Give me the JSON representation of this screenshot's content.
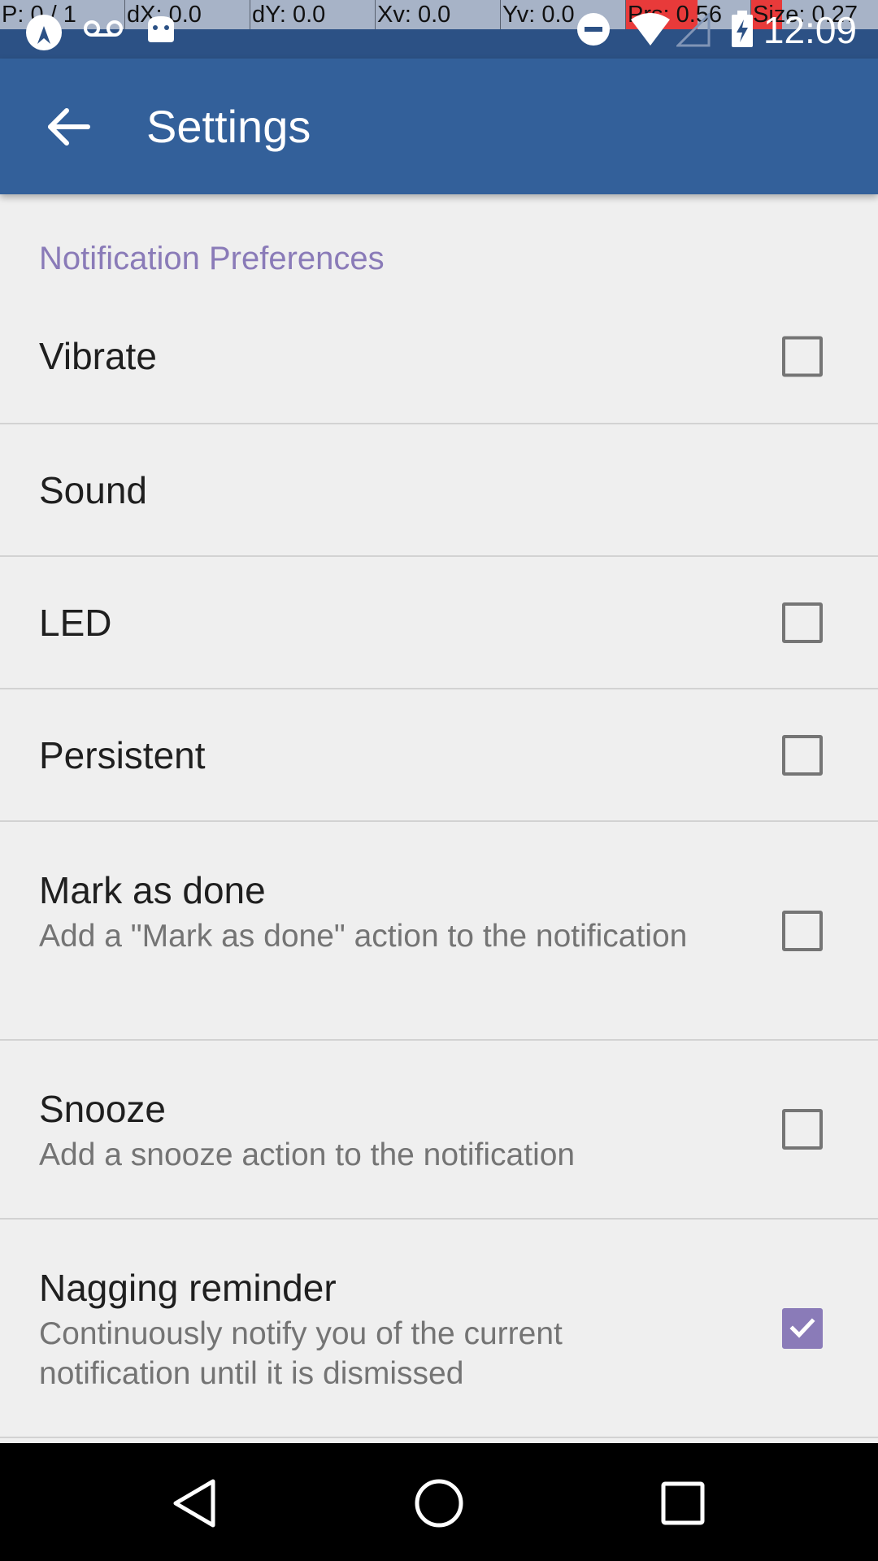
{
  "status_bar": {
    "debug": {
      "pointer": "P: 0 / 1",
      "dx": "dX: 0.0",
      "dy": "dY: 0.0",
      "xv": "Xv: 0.0",
      "yv": "Yv: 0.0",
      "pressure": "Prs: 0.56",
      "size": "Size: 0.27"
    },
    "time": "12:09",
    "icons": [
      "app-notification-icon",
      "voicemail-icon",
      "android-icon",
      "do-not-disturb-icon",
      "wifi-icon",
      "signal-icon",
      "battery-charging-icon"
    ],
    "highlight_color": "#e83a3a"
  },
  "app_bar": {
    "title": "Settings",
    "back_icon": "arrow-back-icon",
    "color": "#33609a"
  },
  "section": {
    "title": "Notification Preferences",
    "color": "#8a7bb8"
  },
  "preferences": [
    {
      "title": "Vibrate",
      "summary": "",
      "checkbox": true,
      "checked": false
    },
    {
      "title": "Sound",
      "summary": "",
      "checkbox": false,
      "checked": false
    },
    {
      "title": "LED",
      "summary": "",
      "checkbox": true,
      "checked": false
    },
    {
      "title": "Persistent",
      "summary": "",
      "checkbox": true,
      "checked": false
    },
    {
      "title": "Mark as done",
      "summary": "Add a \"Mark as done\" action to the notification",
      "checkbox": true,
      "checked": false
    },
    {
      "title": "Snooze",
      "summary": "Add a snooze action to the notification",
      "checkbox": true,
      "checked": false
    },
    {
      "title": "Nagging reminder",
      "summary": "Continuously notify you of the current notification until it is dismissed",
      "checkbox": true,
      "checked": true
    }
  ],
  "nav_bar": {
    "icons": [
      "nav-back-icon",
      "nav-home-icon",
      "nav-recents-icon"
    ]
  }
}
